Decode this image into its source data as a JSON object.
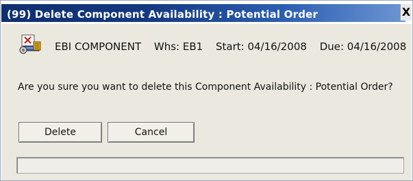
{
  "window": {
    "title": "(99) Delete Component Availability : Potential Order",
    "close_label": "X"
  },
  "item": {
    "name": "EBI COMPONENT",
    "warehouse": "Whs: EB1",
    "start": "Start: 04/16/2008",
    "due": "Due: 04/16/2008"
  },
  "dialog": {
    "question": "Are you sure you want to delete this Component Availability : Potential Order?"
  },
  "buttons": {
    "delete_label": "Delete",
    "cancel_label": "Cancel"
  },
  "progress": {
    "value": 0
  }
}
